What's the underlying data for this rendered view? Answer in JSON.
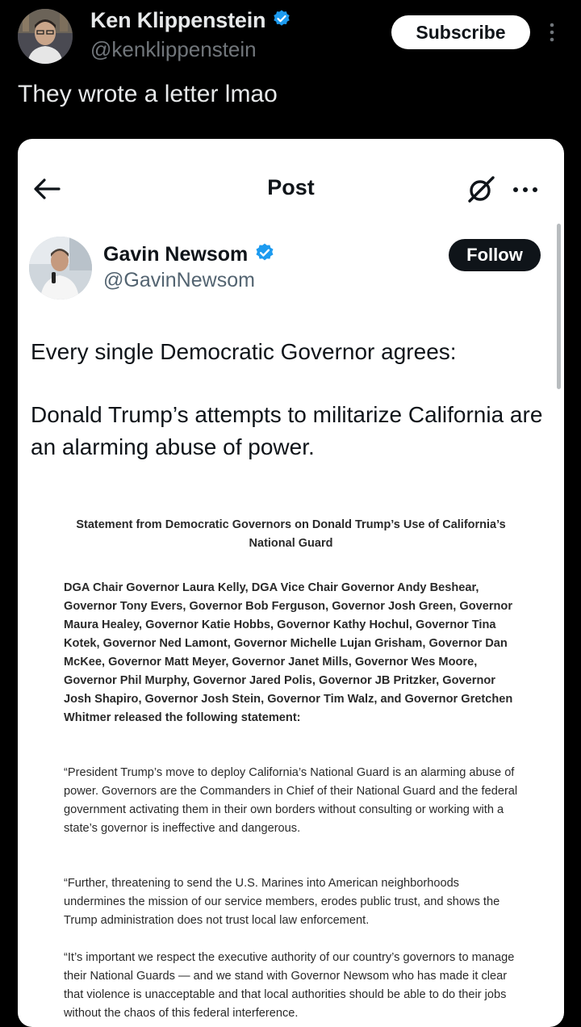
{
  "outer_post": {
    "author_name": "Ken Klippenstein",
    "author_handle": "@kenklippenstein",
    "subscribe_label": "Subscribe",
    "text": "They wrote a letter lmao"
  },
  "card": {
    "header_title": "Post",
    "author_name": "Gavin Newsom",
    "author_handle": "@GavinNewsom",
    "follow_label": "Follow",
    "tweet_paragraphs": [
      "Every single Democratic Governor agrees:",
      "Donald Trump’s attempts to militarize California are an alarming abuse of power."
    ]
  },
  "letter": {
    "title": "Statement from Democratic Governors on Donald Trump’s Use of California’s National Guard",
    "paragraphs": [
      "DGA Chair Governor Laura Kelly, DGA Vice Chair Governor Andy Beshear, Governor Tony Evers, Governor Bob Ferguson, Governor Josh Green, Governor Maura Healey, Governor Katie Hobbs, Governor Kathy Hochul, Governor Tina Kotek, Governor Ned Lamont, Governor Michelle Lujan Grisham, Governor Dan McKee, Governor Matt Meyer, Governor Janet Mills, Governor Wes Moore, Governor Phil Murphy, Governor Jared Polis, Governor JB Pritzker, Governor Josh Shapiro, Governor Josh Stein, Governor Tim Walz, and Governor Gretchen Whitmer released the following statement:",
      "“President Trump’s move to deploy California’s National Guard is an alarming abuse of power. Governors are the Commanders in Chief of their National Guard and the federal government activating them in their own borders without consulting or working with a state’s governor is ineffective and dangerous.",
      "“Further, threatening to send the U.S. Marines into American neighborhoods undermines the mission of our service members, erodes public trust, and shows the Trump administration does not trust local law enforcement.",
      "“It’s important we respect the executive authority of our country’s governors to manage their National Guards — and we stand with Governor Newsom who has made it clear that violence is unacceptable and that local authorities should be able to do their jobs without the chaos of this federal interference."
    ]
  },
  "colors": {
    "verified_blue": "#1d9bf0",
    "background": "#000000",
    "card_background": "#ffffff"
  },
  "icons": [
    "verified-badge-icon",
    "more-icon",
    "back-arrow-icon",
    "grok-icon"
  ]
}
